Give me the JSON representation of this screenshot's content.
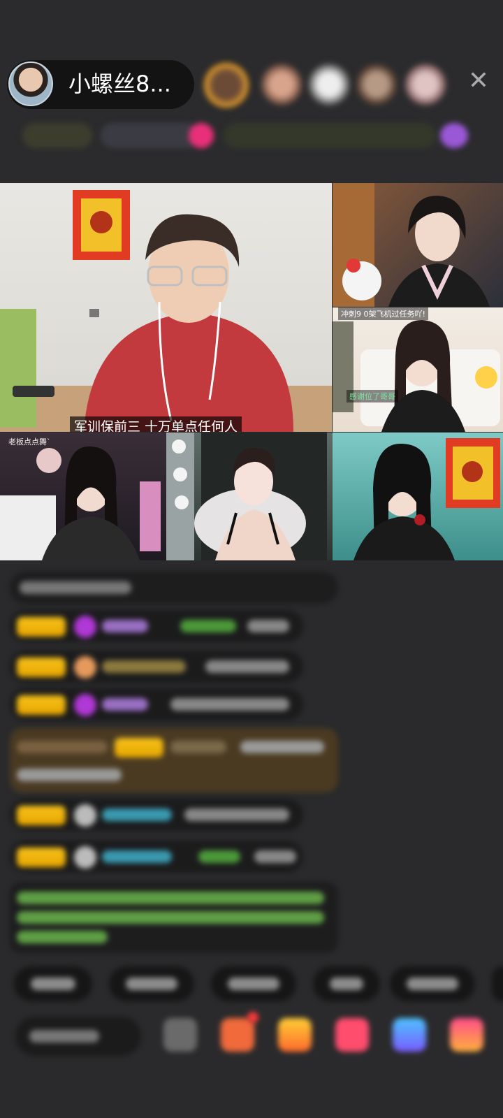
{
  "host": {
    "name": "小螺丝8...",
    "avatar_icon": "host-avatar-icon"
  },
  "top_bar": {
    "close_icon": "close-icon"
  },
  "stream": {
    "main_caption": "军训保前三  十万单点任何人",
    "top_right_banner": "冲刺9 0架飞机过任务吖!",
    "left_bottom_tag": "老板点点舞`",
    "mid_right_small": "感谢位了哥哥"
  },
  "colors": {
    "background": "#2a2a2c",
    "level_badge": "#f4bb13",
    "chat_green": "#6fd04c",
    "chat_purple": "#b67be6",
    "chat_cyan": "#3ab9d1",
    "pk_gradient_pink": "#ff4d8a"
  }
}
